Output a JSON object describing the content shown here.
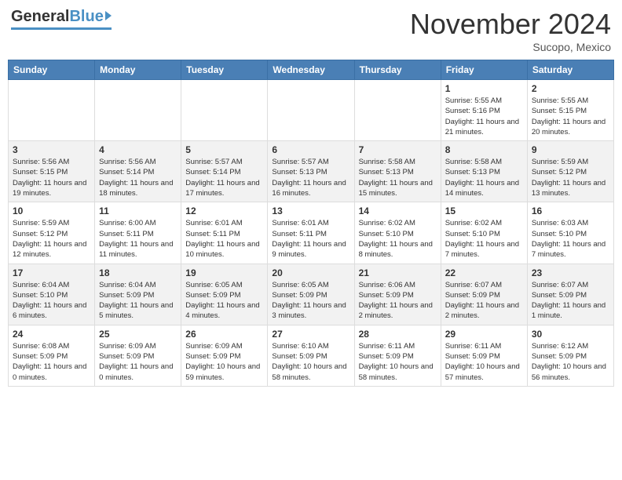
{
  "header": {
    "logo_general": "General",
    "logo_blue": "Blue",
    "month_title": "November 2024",
    "location": "Sucopo, Mexico"
  },
  "days_of_week": [
    "Sunday",
    "Monday",
    "Tuesday",
    "Wednesday",
    "Thursday",
    "Friday",
    "Saturday"
  ],
  "weeks": [
    [
      {
        "day": "",
        "info": ""
      },
      {
        "day": "",
        "info": ""
      },
      {
        "day": "",
        "info": ""
      },
      {
        "day": "",
        "info": ""
      },
      {
        "day": "",
        "info": ""
      },
      {
        "day": "1",
        "info": "Sunrise: 5:55 AM\nSunset: 5:16 PM\nDaylight: 11 hours and 21 minutes."
      },
      {
        "day": "2",
        "info": "Sunrise: 5:55 AM\nSunset: 5:15 PM\nDaylight: 11 hours and 20 minutes."
      }
    ],
    [
      {
        "day": "3",
        "info": "Sunrise: 5:56 AM\nSunset: 5:15 PM\nDaylight: 11 hours and 19 minutes."
      },
      {
        "day": "4",
        "info": "Sunrise: 5:56 AM\nSunset: 5:14 PM\nDaylight: 11 hours and 18 minutes."
      },
      {
        "day": "5",
        "info": "Sunrise: 5:57 AM\nSunset: 5:14 PM\nDaylight: 11 hours and 17 minutes."
      },
      {
        "day": "6",
        "info": "Sunrise: 5:57 AM\nSunset: 5:13 PM\nDaylight: 11 hours and 16 minutes."
      },
      {
        "day": "7",
        "info": "Sunrise: 5:58 AM\nSunset: 5:13 PM\nDaylight: 11 hours and 15 minutes."
      },
      {
        "day": "8",
        "info": "Sunrise: 5:58 AM\nSunset: 5:13 PM\nDaylight: 11 hours and 14 minutes."
      },
      {
        "day": "9",
        "info": "Sunrise: 5:59 AM\nSunset: 5:12 PM\nDaylight: 11 hours and 13 minutes."
      }
    ],
    [
      {
        "day": "10",
        "info": "Sunrise: 5:59 AM\nSunset: 5:12 PM\nDaylight: 11 hours and 12 minutes."
      },
      {
        "day": "11",
        "info": "Sunrise: 6:00 AM\nSunset: 5:11 PM\nDaylight: 11 hours and 11 minutes."
      },
      {
        "day": "12",
        "info": "Sunrise: 6:01 AM\nSunset: 5:11 PM\nDaylight: 11 hours and 10 minutes."
      },
      {
        "day": "13",
        "info": "Sunrise: 6:01 AM\nSunset: 5:11 PM\nDaylight: 11 hours and 9 minutes."
      },
      {
        "day": "14",
        "info": "Sunrise: 6:02 AM\nSunset: 5:10 PM\nDaylight: 11 hours and 8 minutes."
      },
      {
        "day": "15",
        "info": "Sunrise: 6:02 AM\nSunset: 5:10 PM\nDaylight: 11 hours and 7 minutes."
      },
      {
        "day": "16",
        "info": "Sunrise: 6:03 AM\nSunset: 5:10 PM\nDaylight: 11 hours and 7 minutes."
      }
    ],
    [
      {
        "day": "17",
        "info": "Sunrise: 6:04 AM\nSunset: 5:10 PM\nDaylight: 11 hours and 6 minutes."
      },
      {
        "day": "18",
        "info": "Sunrise: 6:04 AM\nSunset: 5:09 PM\nDaylight: 11 hours and 5 minutes."
      },
      {
        "day": "19",
        "info": "Sunrise: 6:05 AM\nSunset: 5:09 PM\nDaylight: 11 hours and 4 minutes."
      },
      {
        "day": "20",
        "info": "Sunrise: 6:05 AM\nSunset: 5:09 PM\nDaylight: 11 hours and 3 minutes."
      },
      {
        "day": "21",
        "info": "Sunrise: 6:06 AM\nSunset: 5:09 PM\nDaylight: 11 hours and 2 minutes."
      },
      {
        "day": "22",
        "info": "Sunrise: 6:07 AM\nSunset: 5:09 PM\nDaylight: 11 hours and 2 minutes."
      },
      {
        "day": "23",
        "info": "Sunrise: 6:07 AM\nSunset: 5:09 PM\nDaylight: 11 hours and 1 minute."
      }
    ],
    [
      {
        "day": "24",
        "info": "Sunrise: 6:08 AM\nSunset: 5:09 PM\nDaylight: 11 hours and 0 minutes."
      },
      {
        "day": "25",
        "info": "Sunrise: 6:09 AM\nSunset: 5:09 PM\nDaylight: 11 hours and 0 minutes."
      },
      {
        "day": "26",
        "info": "Sunrise: 6:09 AM\nSunset: 5:09 PM\nDaylight: 10 hours and 59 minutes."
      },
      {
        "day": "27",
        "info": "Sunrise: 6:10 AM\nSunset: 5:09 PM\nDaylight: 10 hours and 58 minutes."
      },
      {
        "day": "28",
        "info": "Sunrise: 6:11 AM\nSunset: 5:09 PM\nDaylight: 10 hours and 58 minutes."
      },
      {
        "day": "29",
        "info": "Sunrise: 6:11 AM\nSunset: 5:09 PM\nDaylight: 10 hours and 57 minutes."
      },
      {
        "day": "30",
        "info": "Sunrise: 6:12 AM\nSunset: 5:09 PM\nDaylight: 10 hours and 56 minutes."
      }
    ]
  ]
}
